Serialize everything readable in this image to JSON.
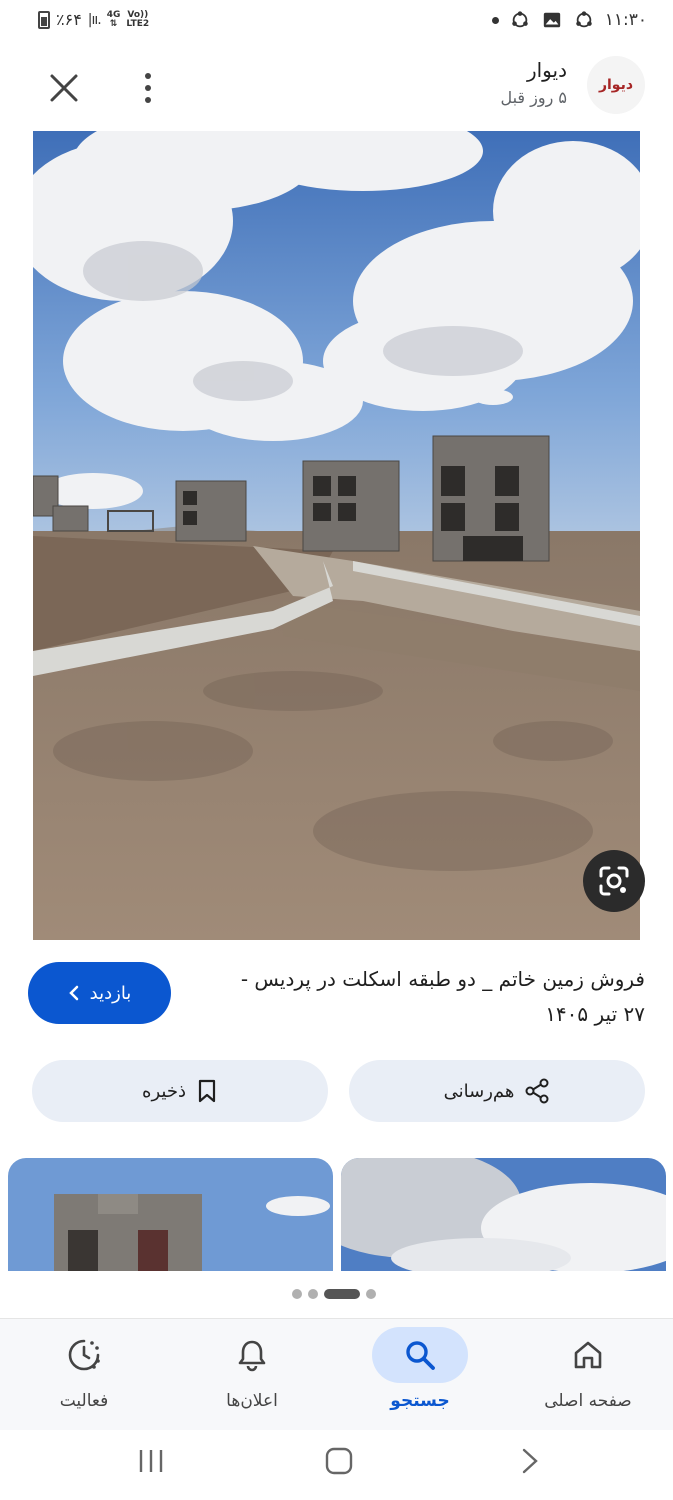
{
  "status_bar": {
    "battery": "٪۶۴",
    "network_top": "4G",
    "network_volte": "Vo))",
    "network_bottom": "LTE2",
    "time": "۱۱:۳۰"
  },
  "header": {
    "source_name": "دیوار",
    "source_time": "۵ روز قبل",
    "logo_text": "دیوار"
  },
  "result": {
    "title": "فروش زمین خاتم _ دو طبقه اسکلت در پردیس - ۲۷ تیر ۱۴۰۵",
    "visit_label": "بازدید"
  },
  "actions": {
    "share_label": "هم‌رسانی",
    "save_label": "ذخیره"
  },
  "pager": {
    "count": 4,
    "active_index": 2
  },
  "bottom_nav": {
    "home": "صفحه اصلی",
    "search": "جستجو",
    "notifications": "اعلان‌ها",
    "activity": "فعالیت"
  },
  "colors": {
    "accent": "#0b57d0",
    "pill_bg": "#e9eef6",
    "active_nav_bg": "#d3e3fd",
    "logo_red": "#a62626"
  },
  "icons": [
    "close-icon",
    "more-vert-icon",
    "lens-icon",
    "chevron-left-icon",
    "share-icon",
    "bookmark-icon",
    "home-icon",
    "search-icon",
    "bell-icon",
    "activity-icon"
  ]
}
